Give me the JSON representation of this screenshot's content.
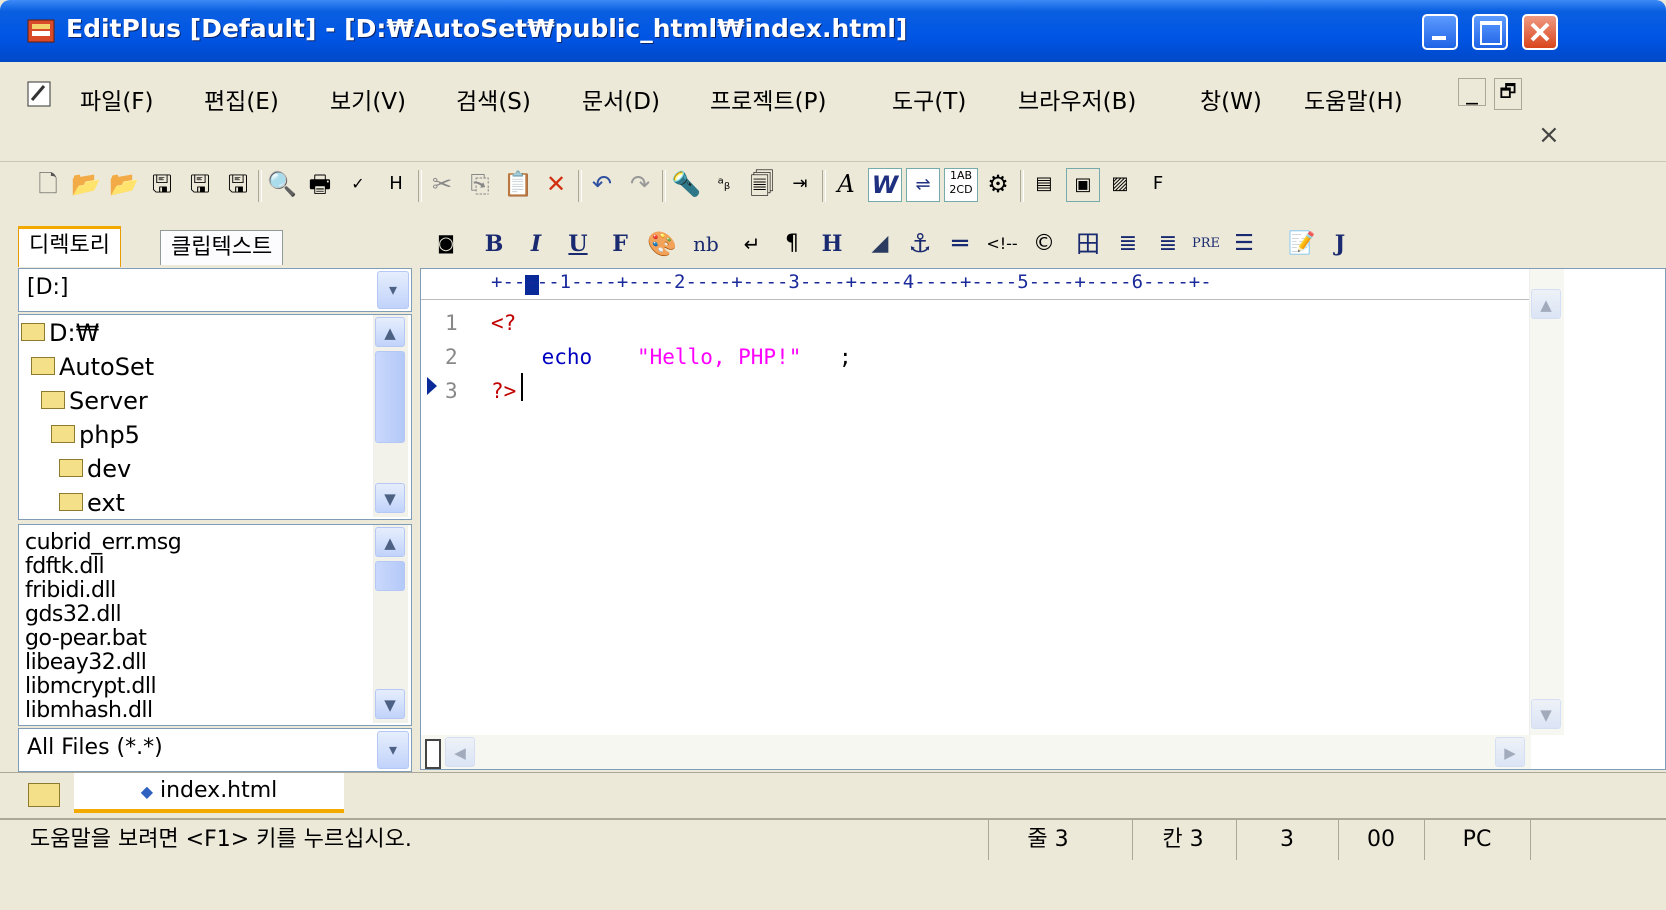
{
  "window": {
    "title": "EditPlus [Default] - [D:₩AutoSet₩public_html₩index.html]"
  },
  "menu": {
    "items": [
      "파일(F)",
      "편집(E)",
      "보기(V)",
      "검색(S)",
      "문서(D)",
      "프로젝트(P)",
      "도구(T)",
      "브라우저(B)",
      "창(W)",
      "도움말(H)"
    ],
    "mdi_minimize": "_",
    "mdi_restore": "🗗",
    "mdi_close": "×"
  },
  "left_panel": {
    "tabs": [
      "디렉토리",
      "클립텍스트"
    ],
    "drive": "[D:]",
    "dir_tree": [
      "D:₩",
      "AutoSet",
      "Server",
      "php5",
      "dev",
      "ext"
    ],
    "files": [
      "cubrid_err.msg",
      "fdftk.dll",
      "fribidi.dll",
      "gds32.dll",
      "go-pear.bat",
      "libeay32.dll",
      "libmcrypt.dll",
      "libmhash.dll"
    ],
    "filter": "All Files (*.*)"
  },
  "html_toolbar": {
    "b": "B",
    "i": "I",
    "u": "U",
    "f": "F",
    "nb": "nb",
    "h": "H",
    "pre": "PRE",
    "j": "J"
  },
  "ruler": "+-----1----+----2----+----3----+----4----+----5----+----6----+-",
  "editor": {
    "lines": [
      {
        "num": "1",
        "parts": [
          "<?"
        ]
      },
      {
        "num": "2",
        "parts": [
          "    echo ",
          "\"Hello, PHP!\"",
          ";"
        ]
      },
      {
        "num": "3",
        "parts": [
          "?>"
        ]
      }
    ]
  },
  "document_tabs": [
    "index.html"
  ],
  "status": {
    "help": "도움말을 보려면 <F1> 키를 누르십시오.",
    "line": "줄 3",
    "col": "칸 3",
    "num": "3",
    "code": "00",
    "mode": "PC"
  },
  "colors": {
    "title_blue": "#0055e5",
    "tag_red": "#c00000",
    "string_magenta": "#ff00ff",
    "keyword_blue": "#0000c0"
  }
}
